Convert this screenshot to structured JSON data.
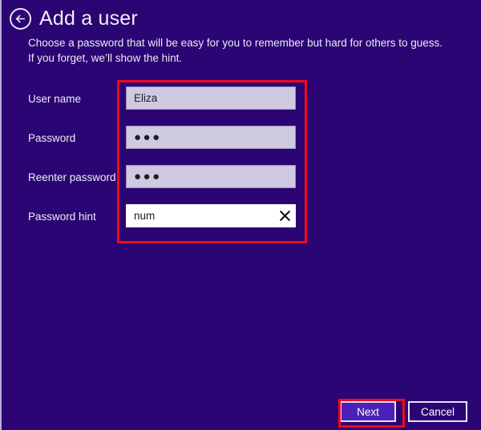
{
  "window": {
    "background_color": "#2B0573",
    "accent_color": "#4B20B8",
    "annotation_color": "#F2081A",
    "field_fill_color": "#CFC9E1"
  },
  "header": {
    "back_label": "Back",
    "title": "Add a user"
  },
  "description": "Choose a password that will be easy for you to remember but hard for others to guess. If you forget, we’ll show the hint.",
  "form": {
    "fields": [
      {
        "label": "User name",
        "value": "Eliza",
        "placeholder": "",
        "masked": false,
        "focused": false,
        "has_clear": false
      },
      {
        "label": "Password",
        "value": "●●●",
        "placeholder": "",
        "masked": true,
        "focused": false,
        "has_clear": false
      },
      {
        "label": "Reenter password",
        "value": "●●●",
        "placeholder": "",
        "masked": true,
        "focused": false,
        "has_clear": false
      },
      {
        "label": "Password hint",
        "value": "num",
        "placeholder": "",
        "masked": false,
        "focused": true,
        "has_clear": true,
        "clear_icon": "close-icon"
      }
    ]
  },
  "footer": {
    "next_label": "Next",
    "cancel_label": "Cancel"
  }
}
